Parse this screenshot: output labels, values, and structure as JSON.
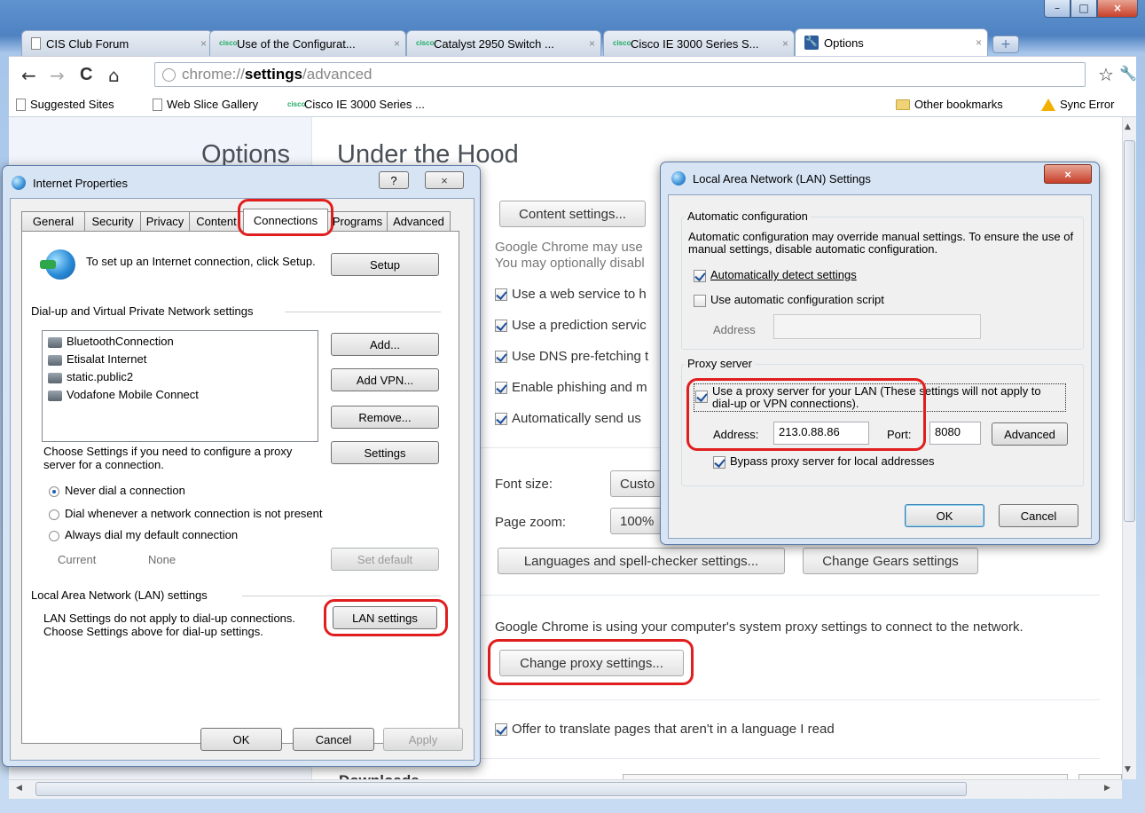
{
  "browser": {
    "tabs": [
      {
        "label": "CIS Club Forum"
      },
      {
        "label": "Use of the Configurat..."
      },
      {
        "label": "Catalyst 2950 Switch ..."
      },
      {
        "label": "Cisco IE 3000 Series S..."
      },
      {
        "label": "Options"
      }
    ],
    "close_glyph": "×",
    "cisco_glyph": "cisco",
    "newtab_glyph": "+",
    "omnibox": {
      "scheme": "chrome://",
      "host": "settings",
      "path": "/advanced"
    },
    "bookmarks": [
      {
        "label": "Suggested Sites"
      },
      {
        "label": "Web Slice Gallery"
      },
      {
        "label": "Cisco IE 3000 Series ..."
      }
    ],
    "other_bookmarks": "Other bookmarks",
    "sync_error": "Sync Error",
    "icons": {
      "back": "←",
      "forward": "→",
      "reload": "C",
      "home": "⌂",
      "star": "☆",
      "wrench": "🔧"
    }
  },
  "options": {
    "sidebar_title": "Options",
    "page_title": "Under the Hood",
    "content_settings_button": "Content settings...",
    "privacy_text_1": "Google Chrome may use",
    "privacy_text_2": "You may optionally disabl",
    "checkboxes": [
      {
        "label": "Use a web service to h",
        "checked": true
      },
      {
        "label": "Use a prediction servic",
        "checked": true
      },
      {
        "label": "Use DNS pre-fetching t",
        "checked": true
      },
      {
        "label": "Enable phishing and m",
        "checked": true
      },
      {
        "label": "Automatically send us",
        "checked": true
      }
    ],
    "font_size_label": "Font size:",
    "font_size_value": "Custo",
    "page_zoom_label": "Page zoom:",
    "page_zoom_value": "100%",
    "languages_button": "Languages and spell-checker settings...",
    "gears_button": "Change Gears settings",
    "proxy_text": "Google Chrome is using your computer's system proxy settings to connect to the network.",
    "change_proxy_button": "Change proxy settings...",
    "translate_label": "Offer to translate pages that aren't in a language I read",
    "downloads_heading": "Downloads"
  },
  "internet_properties": {
    "title": "Internet Properties",
    "help_glyph": "?",
    "close_glyph": "×",
    "tabs": [
      "General",
      "Security",
      "Privacy",
      "Content",
      "Connections",
      "Programs",
      "Advanced"
    ],
    "setup_text": "To set up an Internet connection, click Setup.",
    "setup_button": "Setup",
    "dialup_group": "Dial-up and Virtual Private Network settings",
    "connections": [
      "BluetoothConnection",
      "Etisalat Internet",
      "static.public2",
      "Vodafone Mobile Connect"
    ],
    "add_button": "Add...",
    "add_vpn_button": "Add VPN...",
    "remove_button": "Remove...",
    "settings_text": "Choose Settings if you need to configure a proxy server for a connection.",
    "settings_button": "Settings",
    "radios": [
      {
        "label": "Never dial a connection",
        "selected": true
      },
      {
        "label": "Dial whenever a network connection is not present",
        "selected": false
      },
      {
        "label": "Always dial my default connection",
        "selected": false
      }
    ],
    "current_label": "Current",
    "current_value": "None",
    "set_default_button": "Set default",
    "lan_group": "Local Area Network (LAN) settings",
    "lan_text": "LAN Settings do not apply to dial-up connections. Choose Settings above for dial-up settings.",
    "lan_button": "LAN settings",
    "ok": "OK",
    "cancel": "Cancel",
    "apply": "Apply"
  },
  "lan_dialog": {
    "title": "Local Area Network (LAN) Settings",
    "close_glyph": "×",
    "auto_group": "Automatic configuration",
    "auto_text": "Automatic configuration may override manual settings.  To ensure the use of manual settings, disable automatic configuration.",
    "auto_detect": {
      "label": "Automatically detect settings",
      "checked": true
    },
    "auto_script": {
      "label": "Use automatic configuration script",
      "checked": false
    },
    "script_address_label": "Address",
    "proxy_group": "Proxy server",
    "use_proxy": {
      "label": "Use a proxy server for your LAN (These settings will not apply to dial-up or VPN connections).",
      "checked": true
    },
    "address_label": "Address:",
    "address_value": "213.0.88.86",
    "port_label": "Port:",
    "port_value": "8080",
    "advanced_button": "Advanced",
    "bypass": {
      "label": "Bypass proxy server for local addresses",
      "checked": true
    },
    "ok": "OK",
    "cancel": "Cancel"
  },
  "colors": {
    "highlight": "#e01e1e",
    "titlebar": "#4f82c2"
  }
}
